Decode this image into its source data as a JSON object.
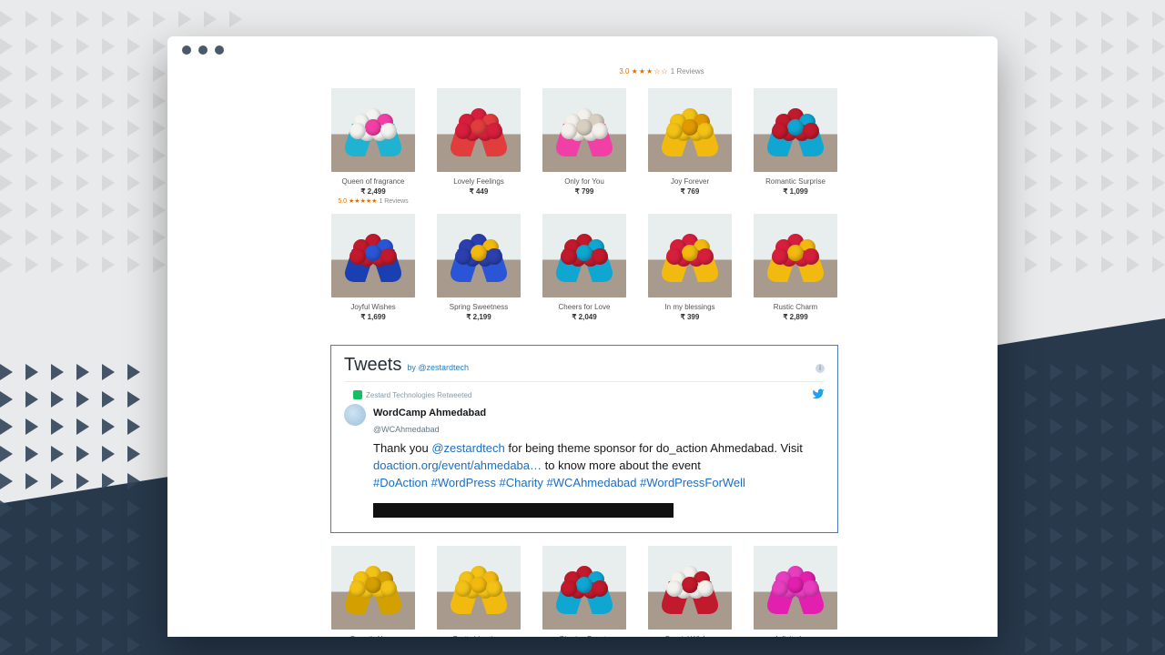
{
  "top_rating": {
    "score": "3.0",
    "stars": "★★★☆☆",
    "count_text": "1 Reviews"
  },
  "rows": [
    {
      "products": [
        {
          "name": "Queen of fragrance",
          "price": "₹ 2,499",
          "rating": {
            "score": "5.0",
            "stars": "★★★★★",
            "count_text": "1 Reviews"
          },
          "palette": {
            "wrap": "#1fb3d1",
            "flower": "#f3f3f0",
            "accent": "#f23fa5"
          }
        },
        {
          "name": "Lovely Feelings",
          "price": "₹ 449",
          "palette": {
            "wrap": "#e13d3d",
            "flower": "#d61f3c",
            "accent": "#e13d3d"
          }
        },
        {
          "name": "Only for You",
          "price": "₹ 799",
          "palette": {
            "wrap": "#f23fa5",
            "flower": "#f4f1ec",
            "accent": "#d8cfc2"
          }
        },
        {
          "name": "Joy Forever",
          "price": "₹ 769",
          "palette": {
            "wrap": "#f2b90f",
            "flower": "#f3c216",
            "accent": "#e09900"
          }
        },
        {
          "name": "Romantic Surprise",
          "price": "₹ 1,099",
          "palette": {
            "wrap": "#0fa6d1",
            "flower": "#c11a2c",
            "accent": "#0fa6d1"
          }
        }
      ]
    },
    {
      "products": [
        {
          "name": "Joyful Wishes",
          "price": "₹ 1,699",
          "palette": {
            "wrap": "#1a3fb3",
            "flower": "#c11a2c",
            "accent": "#2a55d6"
          }
        },
        {
          "name": "Spring Sweetness",
          "price": "₹ 2,199",
          "palette": {
            "wrap": "#2a55d6",
            "flower": "#2b3fae",
            "accent": "#f2b90f"
          }
        },
        {
          "name": "Cheers for Love",
          "price": "₹ 2,049",
          "palette": {
            "wrap": "#0fa6d1",
            "flower": "#c11a2c",
            "accent": "#0fa6d1"
          }
        },
        {
          "name": "In my blessings",
          "price": "₹ 399",
          "palette": {
            "wrap": "#f2b90f",
            "flower": "#d61f3c",
            "accent": "#f2b90f"
          }
        },
        {
          "name": "Rustic Charm",
          "price": "₹ 2,899",
          "palette": {
            "wrap": "#f2b90f",
            "flower": "#d61f3c",
            "accent": "#f2b90f"
          }
        }
      ]
    },
    {
      "products": [
        {
          "name": "Sweetly Yours",
          "price": "",
          "palette": {
            "wrap": "#d4a000",
            "flower": "#f3c216",
            "accent": "#d4a000"
          }
        },
        {
          "name": "Pretty blessings",
          "price": "",
          "palette": {
            "wrap": "#f2b90f",
            "flower": "#f3c216",
            "accent": "#f2b90f"
          }
        },
        {
          "name": "Glowing Beauty",
          "price": "",
          "palette": {
            "wrap": "#0fa6d1",
            "flower": "#c11a2c",
            "accent": "#0fa6d1"
          }
        },
        {
          "name": "Special Wishes",
          "price": "",
          "palette": {
            "wrap": "#c11a2c",
            "flower": "#f3f2ee",
            "accent": "#c11a2c"
          }
        },
        {
          "name": "Infinite Love",
          "price": "",
          "palette": {
            "wrap": "#e21fae",
            "flower": "#e73ec0",
            "accent": "#e21fae"
          }
        }
      ]
    }
  ],
  "tweets": {
    "title": "Tweets",
    "byline": "by @zestardtech",
    "retweet_label": "Zestard Technologies Retweeted",
    "tweet": {
      "name": "WordCamp Ahmedabad",
      "handle": "@WCAhmedabad",
      "text_prefix": "Thank you ",
      "mention": "@zestardtech",
      "text_mid": " for being theme sponsor for do_action Ahmedabad. Visit ",
      "link": "doaction.org/event/ahmedaba…",
      "text_after": " to know more about the event",
      "hashtags": "#DoAction #WordPress #Charity #WCAhmedabad #WordPressForWell"
    }
  }
}
